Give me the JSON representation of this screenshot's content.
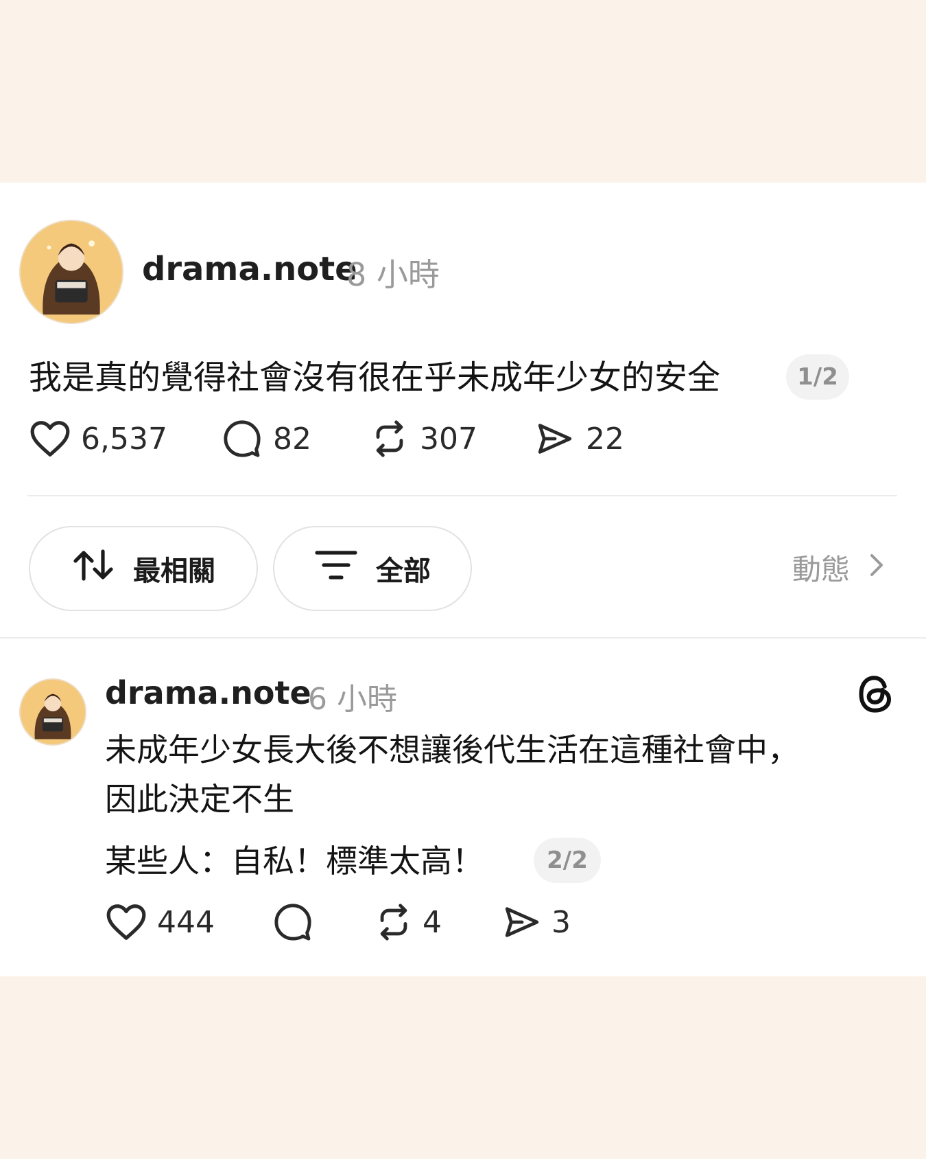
{
  "post": {
    "username": "drama.note",
    "time": "8 小時",
    "text": "我是真的覺得社會沒有很在乎未成年少女的安全",
    "pager": "1/2",
    "likes": "6,537",
    "comments": "82",
    "reposts": "307",
    "shares": "22"
  },
  "filters": {
    "sort_label": "最相關",
    "filter_label": "全部",
    "activity_label": "動態"
  },
  "reply": {
    "username": "drama.note",
    "time": "6 小時",
    "line1": "未成年少女長大後不想讓後代生活在這種社會中，",
    "line2": "因此決定不生",
    "line3": "某些人：自私！標準太高！",
    "pager": "2/2",
    "likes": "444",
    "comments": "",
    "reposts": "4",
    "shares": "3"
  },
  "icons": {
    "like": "heart-icon",
    "comment": "comment-bubble-icon",
    "repost": "repost-icon",
    "share": "send-icon",
    "sort": "sort-arrows-icon",
    "filter": "filter-lines-icon",
    "chevron": "chevron-right-icon",
    "app": "threads-logo-icon"
  },
  "colors": {
    "background": "#fbf2e9",
    "card": "#ffffff",
    "muted": "#9a9a9a"
  }
}
